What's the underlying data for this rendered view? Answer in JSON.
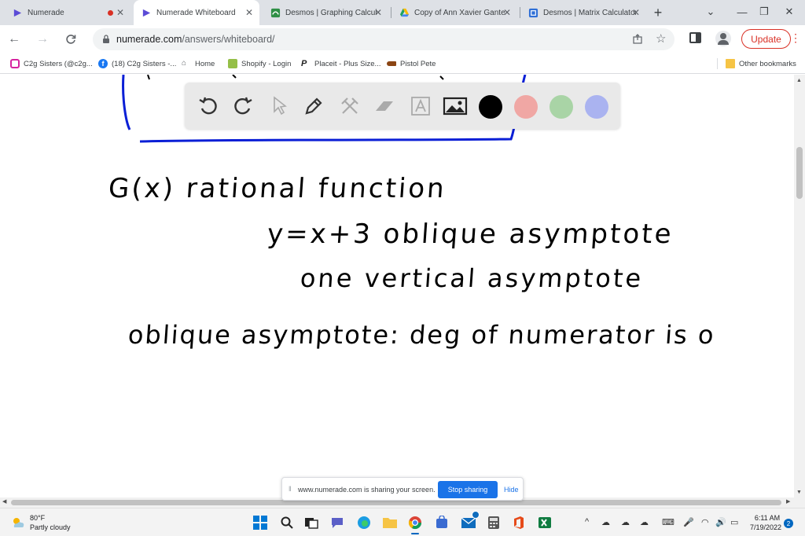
{
  "tabs": [
    {
      "title": "Numerade",
      "active": false,
      "recording": true
    },
    {
      "title": "Numerade Whiteboard",
      "active": true
    },
    {
      "title": "Desmos | Graphing Calcul",
      "active": false
    },
    {
      "title": "Copy of Ann Xavier Gante",
      "active": false
    },
    {
      "title": "Desmos | Matrix Calculator",
      "active": false
    }
  ],
  "new_tab_label": "+",
  "address": {
    "domain": "numerade.com",
    "path": "/answers/whiteboard/"
  },
  "update_label": "Update",
  "bookmarks": [
    {
      "label": "C2g Sisters (@c2g...",
      "icon": "instagram-icon"
    },
    {
      "label": "(18) C2g Sisters -...",
      "icon": "facebook-icon"
    },
    {
      "label": "Home",
      "icon": "home-icon"
    },
    {
      "label": "Shopify - Login",
      "icon": "shopify-icon"
    },
    {
      "label": "Placeit - Plus Size...",
      "icon": "placeit-icon"
    },
    {
      "label": "Pistol Pete",
      "icon": "pistol-icon"
    }
  ],
  "other_bookmarks": "Other bookmarks",
  "whiteboard": {
    "tools": [
      "undo",
      "redo",
      "select",
      "pen",
      "tools",
      "eraser",
      "text",
      "image"
    ],
    "colors": [
      "#000000",
      "#f0a7a4",
      "#a9d4a6",
      "#aab3f0"
    ],
    "handwriting": {
      "line1": "G(x) rational function",
      "line2": "y=x+3 oblique asymptote",
      "line3": "one vertical asymptote",
      "line4": "oblique asymptote: deg of numerator is o"
    }
  },
  "share": {
    "message": "www.numerade.com is sharing your screen.",
    "stop": "Stop sharing",
    "hide": "Hide"
  },
  "weather": {
    "temp": "80°F",
    "desc": "Partly cloudy"
  },
  "clock": {
    "time": "6:11 AM",
    "date": "7/19/2022"
  },
  "notifications": "2"
}
